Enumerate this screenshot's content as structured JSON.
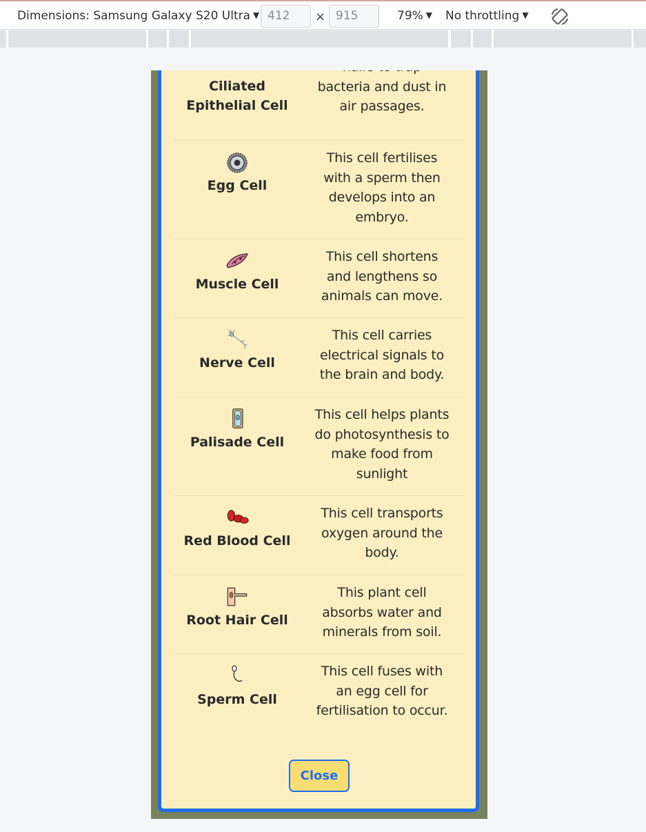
{
  "devtools": {
    "dimensions_label": "Dimensions: Samsung Galaxy S20 Ultra",
    "width": "412",
    "height": "915",
    "times": "×",
    "zoom": "79%",
    "throttling": "No throttling",
    "caret": "▼"
  },
  "cells": [
    {
      "name_lines": [
        "Ciliated",
        "Epithelial Cell"
      ],
      "desc_lines": [
        "hairs to trap",
        "bacteria and dust in",
        "air passages."
      ],
      "icon": "none"
    },
    {
      "name_lines": [
        "Egg Cell"
      ],
      "desc_lines": [
        "This cell fertilises",
        "with a sperm then",
        "develops into an",
        "embryo."
      ],
      "icon": "egg-cell-icon"
    },
    {
      "name_lines": [
        "Muscle Cell"
      ],
      "desc_lines": [
        "This cell shortens",
        "and lengthens so",
        "animals can move."
      ],
      "icon": "muscle-cell-icon"
    },
    {
      "name_lines": [
        "Nerve Cell"
      ],
      "desc_lines": [
        "This cell carries",
        "electrical signals to",
        "the brain and body."
      ],
      "icon": "nerve-cell-icon"
    },
    {
      "name_lines": [
        "Palisade Cell"
      ],
      "desc_lines": [
        "This cell helps plants",
        "do photosynthesis to",
        "make food from",
        "sunlight"
      ],
      "icon": "palisade-cell-icon"
    },
    {
      "name_lines": [
        "Red Blood Cell"
      ],
      "desc_lines": [
        "This cell transports",
        "oxygen around the",
        "body."
      ],
      "icon": "red-blood-cell-icon"
    },
    {
      "name_lines": [
        "Root Hair Cell"
      ],
      "desc_lines": [
        "This plant cell",
        "absorbs water and",
        "minerals from soil."
      ],
      "icon": "root-hair-cell-icon"
    },
    {
      "name_lines": [
        "Sperm Cell"
      ],
      "desc_lines": [
        "This cell fuses with",
        "an egg cell for",
        "fertilisation to occur."
      ],
      "icon": "sperm-cell-icon"
    }
  ],
  "close_label": "Close",
  "colors": {
    "modal_background": "#fbefc1",
    "modal_border": "#1d6ff2",
    "page_background": "#77825e",
    "button_background": "#fbdd73"
  }
}
